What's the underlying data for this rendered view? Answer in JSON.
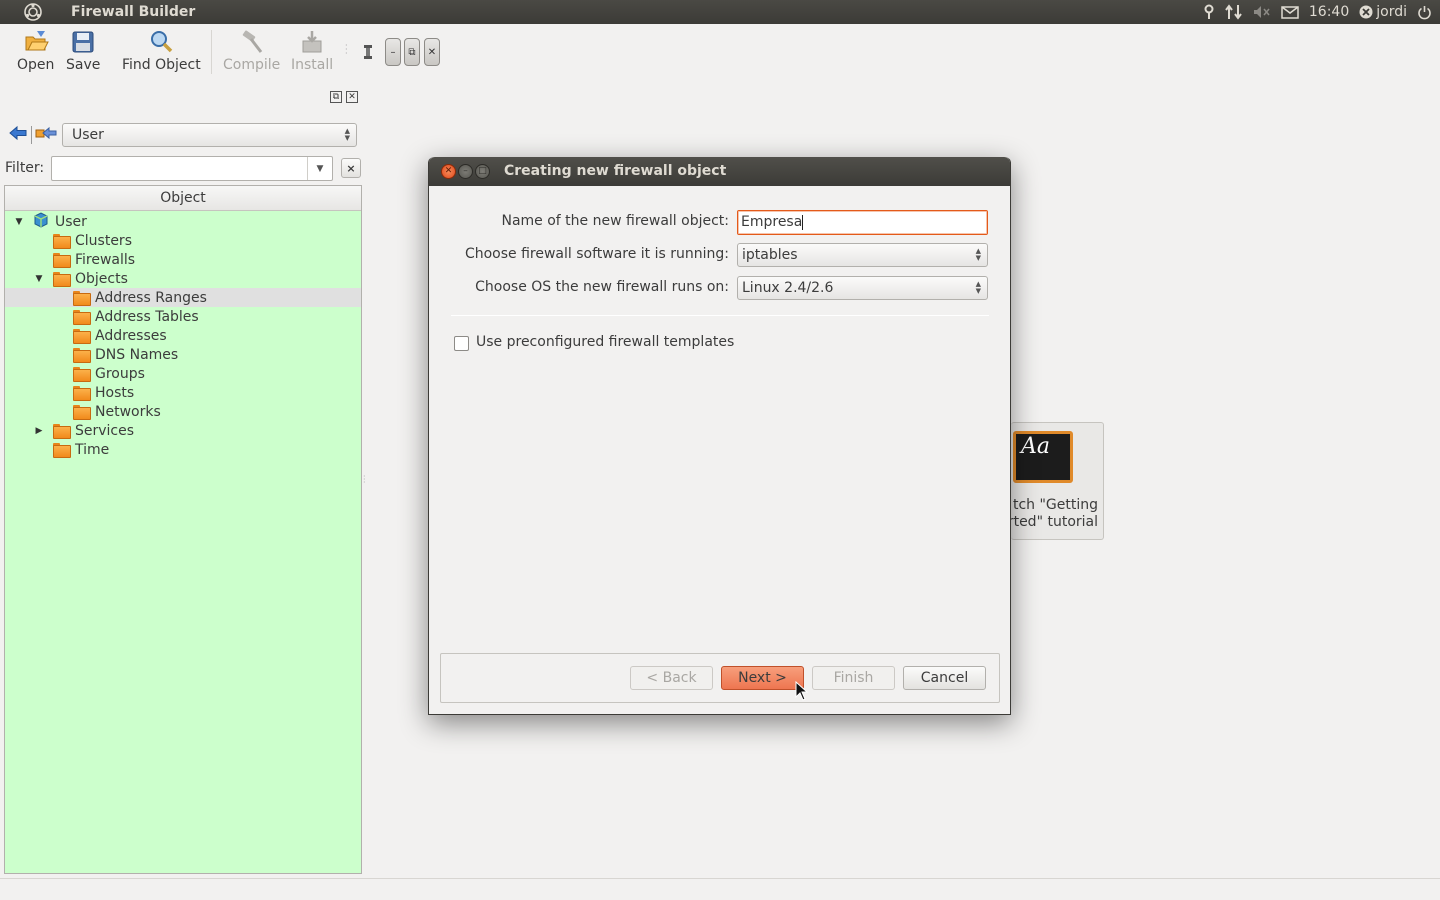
{
  "top_panel": {
    "app_title": "Firewall Builder",
    "clock": "16:40",
    "user": "jordi"
  },
  "toolbar": {
    "open": "Open",
    "save": "Save",
    "find_object": "Find Object",
    "compile": "Compile",
    "install": "Install"
  },
  "left_panel": {
    "library_selected": "User",
    "filter_label": "Filter:",
    "filter_value": "",
    "clear_label": "×",
    "tree_header": "Object",
    "tree": [
      {
        "label": "User",
        "level": 0,
        "expander": "▼",
        "icon": "library-icon"
      },
      {
        "label": "Clusters",
        "level": 1,
        "expander": "",
        "icon": "folder-icon"
      },
      {
        "label": "Firewalls",
        "level": 1,
        "expander": "",
        "icon": "folder-icon"
      },
      {
        "label": "Objects",
        "level": 1,
        "expander": "▼",
        "icon": "folder-icon"
      },
      {
        "label": "Address Ranges",
        "level": 2,
        "expander": "",
        "icon": "folder-icon",
        "selected": true
      },
      {
        "label": "Address Tables",
        "level": 2,
        "expander": "",
        "icon": "folder-icon"
      },
      {
        "label": "Addresses",
        "level": 2,
        "expander": "",
        "icon": "folder-icon"
      },
      {
        "label": "DNS Names",
        "level": 2,
        "expander": "",
        "icon": "folder-icon"
      },
      {
        "label": "Groups",
        "level": 2,
        "expander": "",
        "icon": "folder-icon"
      },
      {
        "label": "Hosts",
        "level": 2,
        "expander": "",
        "icon": "folder-icon"
      },
      {
        "label": "Networks",
        "level": 2,
        "expander": "",
        "icon": "folder-icon"
      },
      {
        "label": "Services",
        "level": 1,
        "expander": "▶",
        "icon": "folder-icon"
      },
      {
        "label": "Time",
        "level": 1,
        "expander": "",
        "icon": "folder-icon"
      }
    ]
  },
  "dialog": {
    "title": "Creating new firewall object",
    "name_label": "Name of the new firewall object:",
    "name_value": "Empresa",
    "software_label": "Choose firewall software it is running:",
    "software_value": "iptables",
    "os_label": "Choose OS the new firewall runs on:",
    "os_value": "Linux 2.4/2.6",
    "templates_label": "Use preconfigured firewall templates",
    "templates_checked": false,
    "back_label": "< Back",
    "next_label": "Next >",
    "finish_label": "Finish",
    "cancel_label": "Cancel"
  },
  "welcome_tile": {
    "icon_text": "Aa",
    "line1": "tch \"Getting",
    "line2": "rted\" tutorial"
  },
  "colors": {
    "tree_background": "#ccffcc",
    "accent": "#ee7550",
    "panel": "#3c3b37"
  }
}
